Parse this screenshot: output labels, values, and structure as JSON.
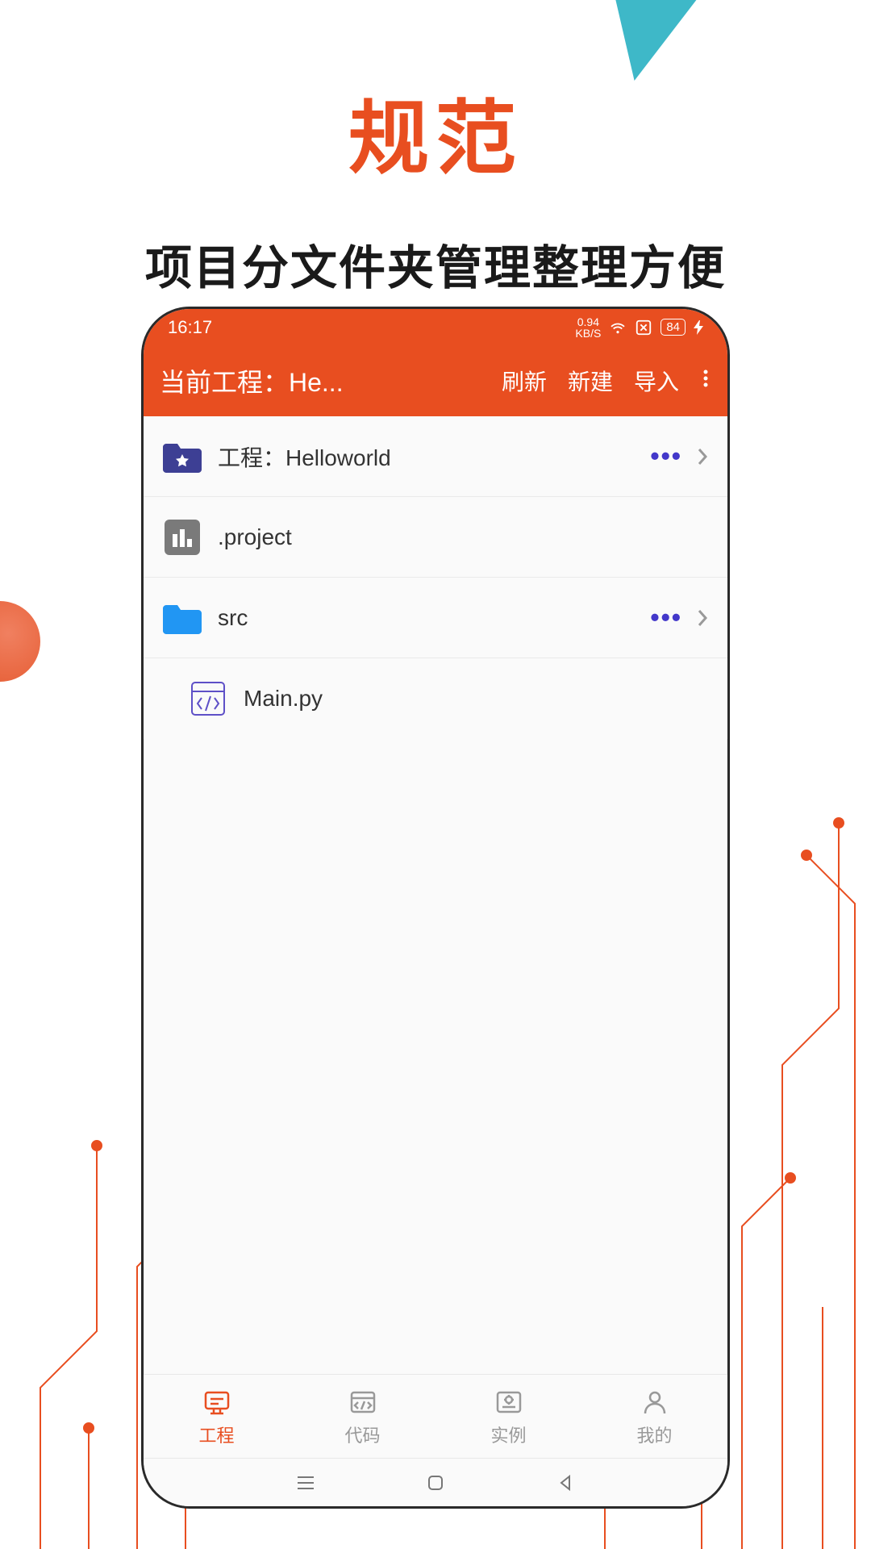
{
  "page_title": "规范",
  "page_subtitle": "项目分文件夹管理整理方便",
  "status_bar": {
    "time": "16:17",
    "speed_top": "0.94",
    "speed_bottom": "KB/S",
    "battery": "84"
  },
  "app_bar": {
    "title": "当前工程：He...",
    "actions": {
      "refresh": "刷新",
      "new": "新建",
      "import": "导入"
    }
  },
  "file_list": [
    {
      "type": "project",
      "name": "工程：Helloworld",
      "has_actions": true,
      "indent": false
    },
    {
      "type": "config",
      "name": ".project",
      "has_actions": false,
      "indent": false
    },
    {
      "type": "folder",
      "name": "src",
      "has_actions": true,
      "indent": false
    },
    {
      "type": "file",
      "name": "Main.py",
      "has_actions": false,
      "indent": true
    }
  ],
  "bottom_nav": [
    {
      "label": "工程",
      "icon": "project",
      "active": true
    },
    {
      "label": "代码",
      "icon": "code",
      "active": false
    },
    {
      "label": "实例",
      "icon": "instance",
      "active": false
    },
    {
      "label": "我的",
      "icon": "profile",
      "active": false
    }
  ]
}
